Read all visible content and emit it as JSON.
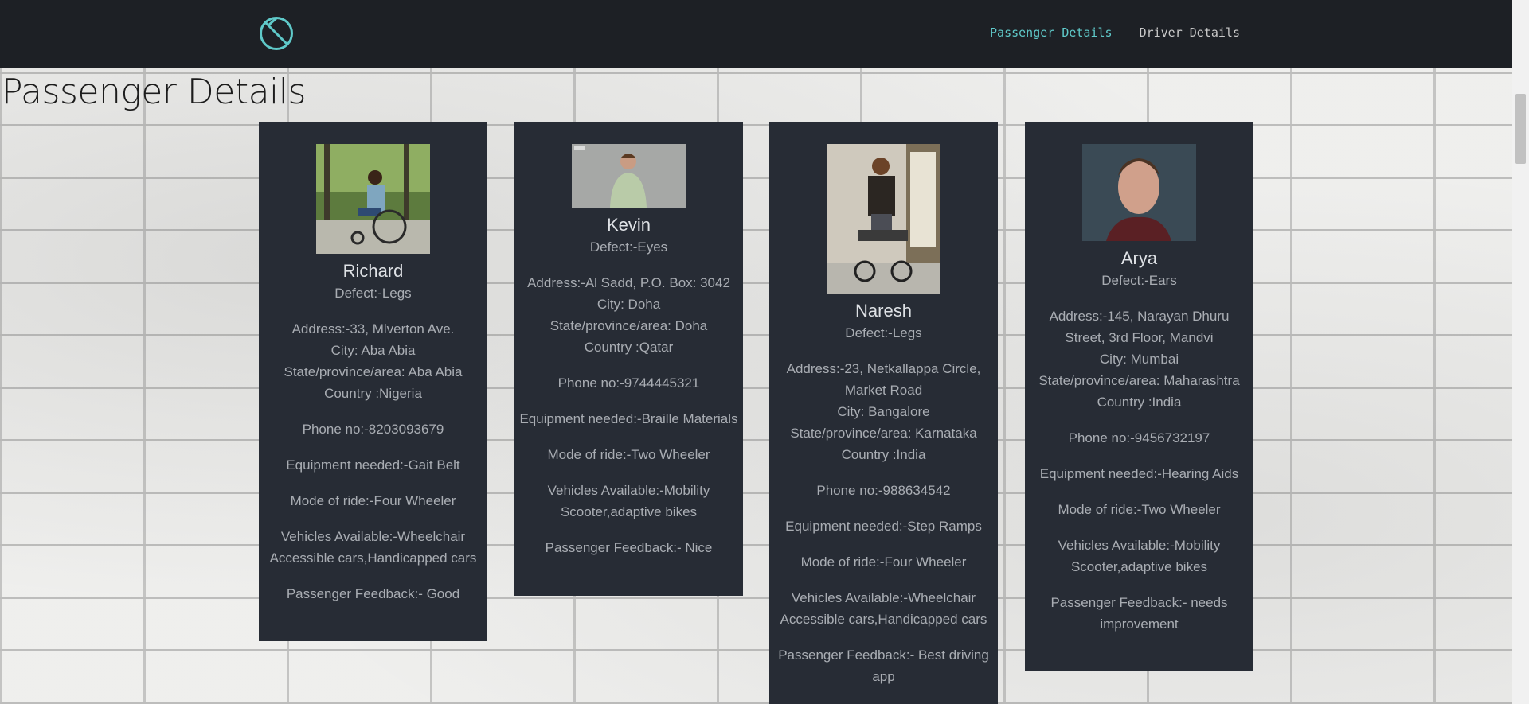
{
  "nav": {
    "links": [
      "Passenger Details",
      "Driver Details"
    ]
  },
  "page_title": "Passenger Details",
  "accent_color": "#5fc9c9",
  "cards": [
    {
      "name": "Richard",
      "defect": "Defect:-Legs",
      "address": "Address:-33, Mlverton Ave.",
      "city": "City: Aba Abia",
      "state": "State/province/area: Aba Abia",
      "country": "Country :Nigeria",
      "phone": "Phone no:-8203093679",
      "equipment": "Equipment needed:-Gait Belt",
      "mode": "Mode of ride:-Four Wheeler",
      "vehicles": "Vehicles Available:-Wheelchair Accessible cars,Handicapped cars",
      "feedback": "Passenger Feedback:- Good"
    },
    {
      "name": "Kevin",
      "defect": "Defect:-Eyes",
      "address": "Address:-Al Sadd, P.O. Box: 3042",
      "city": "City: Doha",
      "state": "State/province/area: Doha",
      "country": "Country :Qatar",
      "phone": "Phone no:-9744445321",
      "equipment": "Equipment needed:-Braille Materials",
      "mode": "Mode of ride:-Two Wheeler",
      "vehicles": "Vehicles Available:-Mobility Scooter,adaptive bikes",
      "feedback": "Passenger Feedback:- Nice"
    },
    {
      "name": "Naresh",
      "defect": "Defect:-Legs",
      "address": "Address:-23, Netkallappa Circle, Market Road",
      "city": "City: Bangalore",
      "state": "State/province/area: Karnataka",
      "country": "Country :India",
      "phone": "Phone no:-988634542",
      "equipment": "Equipment needed:-Step Ramps",
      "mode": "Mode of ride:-Four Wheeler",
      "vehicles": "Vehicles Available:-Wheelchair Accessible cars,Handicapped cars",
      "feedback": "Passenger Feedback:- Best driving app"
    },
    {
      "name": "Arya",
      "defect": "Defect:-Ears",
      "address": "Address:-145, Narayan Dhuru Street, 3rd Floor, Mandvi",
      "city": "City: Mumbai",
      "state": "State/province/area: Maharashtra",
      "country": "Country :India",
      "phone": "Phone no:-9456732197",
      "equipment": "Equipment needed:-Hearing Aids",
      "mode": "Mode of ride:-Two Wheeler",
      "vehicles": "Vehicles Available:-Mobility Scooter,adaptive bikes",
      "feedback": "Passenger Feedback:- needs improvement"
    }
  ]
}
